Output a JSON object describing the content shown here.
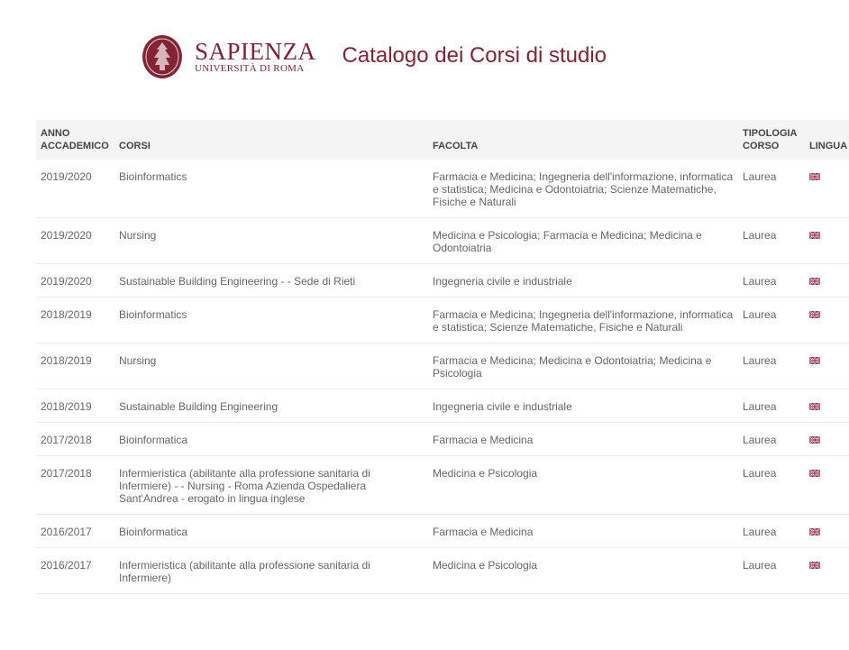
{
  "brand": {
    "name": "SAPIENZA",
    "sub": "UNIVERSITÀ DI ROMA",
    "seal_color": "#822433"
  },
  "title": "Catalogo dei Corsi di studio",
  "table": {
    "headers": {
      "year": "ANNO ACCADEMICO",
      "corsi": "CORSI",
      "facolta": "FACOLTA",
      "tipologia": "TIPOLOGIA CORSO",
      "lingua": "LINGUA"
    },
    "rows": [
      {
        "year": "2019/2020",
        "corso": "Bioinformatics",
        "facolta": "Farmacia e Medicina; Ingegneria dell'informazione, informatica e statistica; Medicina e Odontoiatria; Scienze Matematiche, Fisiche e Naturali",
        "tipologia": "Laurea",
        "lingua": "uk-flag-icon"
      },
      {
        "year": "2019/2020",
        "corso": "Nursing",
        "facolta": "Medicina e Psicologia; Farmacia e Medicina; Medicina e Odontoiatria",
        "tipologia": "Laurea",
        "lingua": "uk-flag-icon"
      },
      {
        "year": "2019/2020",
        "corso": "Sustainable Building Engineering - - Sede di Rieti",
        "facolta": "Ingegneria civile e industriale",
        "tipologia": "Laurea",
        "lingua": "uk-flag-icon"
      },
      {
        "year": "2018/2019",
        "corso": "Bioinformatics",
        "facolta": "Farmacia e Medicina; Ingegneria dell'informazione, informatica e statistica; Scienze Matematiche, Fisiche e Naturali",
        "tipologia": "Laurea",
        "lingua": "uk-flag-icon"
      },
      {
        "year": "2018/2019",
        "corso": "Nursing",
        "facolta": "Farmacia e Medicina; Medicina e Odontoiatria; Medicina e Psicologia",
        "tipologia": "Laurea",
        "lingua": "uk-flag-icon"
      },
      {
        "year": "2018/2019",
        "corso": "Sustainable Building Engineering",
        "facolta": "Ingegneria civile e industriale",
        "tipologia": "Laurea",
        "lingua": "uk-flag-icon"
      },
      {
        "year": "2017/2018",
        "corso": "Bioinformatica",
        "facolta": "Farmacia e Medicina",
        "tipologia": "Laurea",
        "lingua": "uk-flag-icon"
      },
      {
        "year": "2017/2018",
        "corso": "Infermieristica (abilitante alla professione sanitaria di Infermiere) - - Nursing - Roma Azienda Ospedaliera Sant'Andrea - erogato in lingua inglese",
        "facolta": "Medicina e Psicologia",
        "tipologia": "Laurea",
        "lingua": "uk-flag-icon"
      },
      {
        "year": "2016/2017",
        "corso": "Bioinformatica",
        "facolta": "Farmacia e Medicina",
        "tipologia": "Laurea",
        "lingua": "uk-flag-icon"
      },
      {
        "year": "2016/2017",
        "corso": "Infermieristica (abilitante alla professione sanitaria di Infermiere)",
        "facolta": "Medicina e Psicologia",
        "tipologia": "Laurea",
        "lingua": "uk-flag-icon"
      }
    ]
  }
}
